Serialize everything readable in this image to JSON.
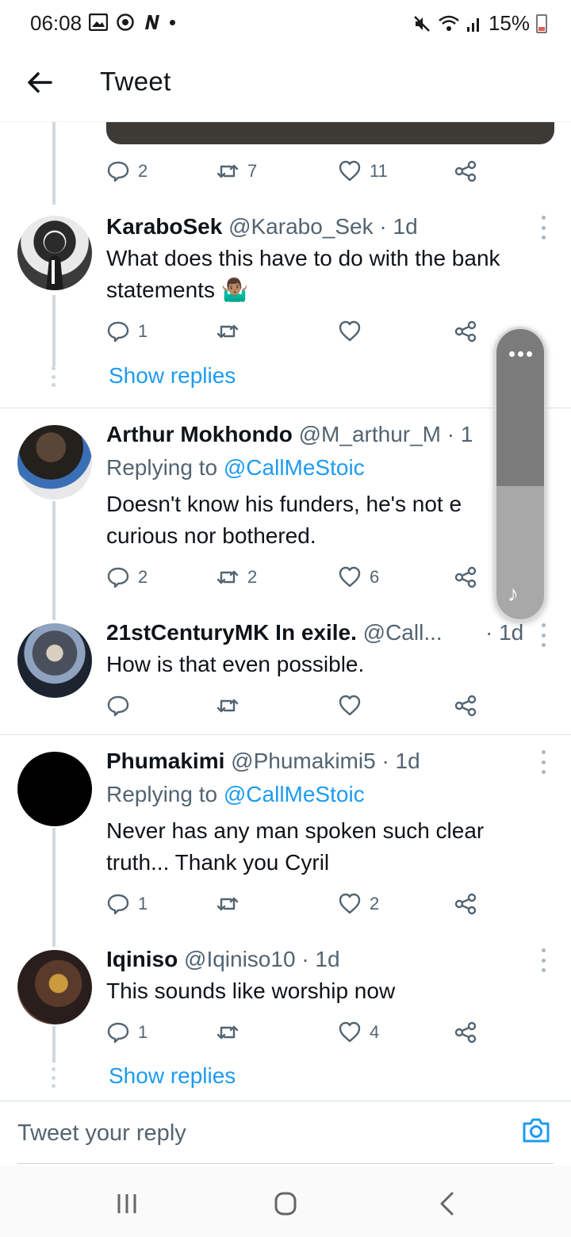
{
  "status_bar": {
    "time": "06:08",
    "battery": "15%"
  },
  "header": {
    "title": "Tweet"
  },
  "top_actions": {
    "replies": "2",
    "retweets": "7",
    "likes": "11"
  },
  "tweets": [
    {
      "name": "KaraboSek",
      "handle": "@Karabo_Sek",
      "time": "· 1d",
      "replying_to": "",
      "text": "What does this have to do with the bank statements 🤷🏽‍♂️",
      "replies": "1",
      "retweets": "",
      "likes": "",
      "show_replies": "Show replies"
    },
    {
      "name": "Arthur Mokhondo",
      "handle": "@M_arthur_M",
      "time": "· 1",
      "replying_prefix": "Replying to ",
      "replying_to": "@CallMeStoic",
      "text": "Doesn't know his funders, he's not e curious nor bothered.",
      "replies": "2",
      "retweets": "2",
      "likes": "6"
    },
    {
      "name": "21stCenturyMK In exile.",
      "handle": "@Call...",
      "time": "· 1d",
      "text": "How is that even possible.",
      "replies": "",
      "retweets": "",
      "likes": ""
    },
    {
      "name": "Phumakimi",
      "handle": "@Phumakimi5",
      "time": "· 1d",
      "replying_prefix": "Replying to ",
      "replying_to": "@CallMeStoic",
      "text": "Never has any man spoken such clear truth... Thank you Cyril",
      "replies": "1",
      "retweets": "",
      "likes": "2"
    },
    {
      "name": "Iqiniso",
      "handle": "@Iqiniso10",
      "time": "· 1d",
      "text": "This sounds like worship now",
      "replies": "1",
      "retweets": "",
      "likes": "4",
      "show_replies": "Show replies"
    }
  ],
  "reply_bar": {
    "placeholder": "Tweet your reply"
  },
  "colors": {
    "accent": "#1d9bf0",
    "secondary_text": "#536471"
  }
}
